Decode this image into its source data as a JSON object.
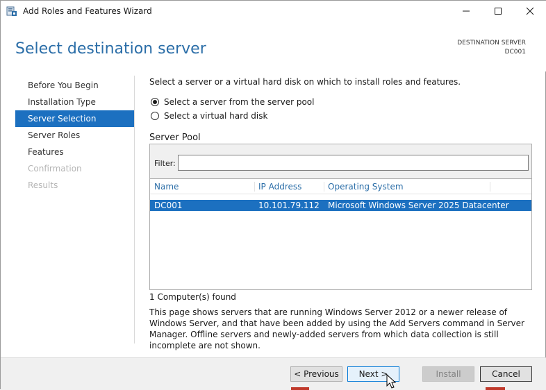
{
  "window": {
    "title": "Add Roles and Features Wizard"
  },
  "header": {
    "page_title": "Select destination server",
    "destination_label": "DESTINATION SERVER",
    "destination_server": "DC001"
  },
  "nav": {
    "items": [
      {
        "label": "Before You Begin",
        "state": "normal"
      },
      {
        "label": "Installation Type",
        "state": "normal"
      },
      {
        "label": "Server Selection",
        "state": "active"
      },
      {
        "label": "Server Roles",
        "state": "normal"
      },
      {
        "label": "Features",
        "state": "normal"
      },
      {
        "label": "Confirmation",
        "state": "disabled"
      },
      {
        "label": "Results",
        "state": "disabled"
      }
    ]
  },
  "content": {
    "instruction": "Select a server or a virtual hard disk on which to install roles and features.",
    "options": [
      {
        "label": "Select a server from the server pool",
        "checked": true
      },
      {
        "label": "Select a virtual hard disk",
        "checked": false
      }
    ],
    "pool_label": "Server Pool",
    "filter_label": "Filter:",
    "filter_value": "",
    "columns": [
      "Name",
      "IP Address",
      "Operating System"
    ],
    "rows": [
      {
        "name": "DC001",
        "ip": "10.101.79.112",
        "os": "Microsoft Windows Server 2025 Datacenter",
        "selected": true
      }
    ],
    "found_text": "1 Computer(s) found",
    "description": "This page shows servers that are running Windows Server 2012 or a newer release of Windows Server, and that have been added by using the Add Servers command in Server Manager. Offline servers and newly-added servers from which data collection is still incomplete are not shown."
  },
  "footer": {
    "previous_label": "< Previous",
    "next_label": "Next >",
    "install_label": "Install",
    "cancel_label": "Cancel"
  },
  "colors": {
    "accent": "#1c70c0",
    "title_blue": "#2b6ea8"
  }
}
